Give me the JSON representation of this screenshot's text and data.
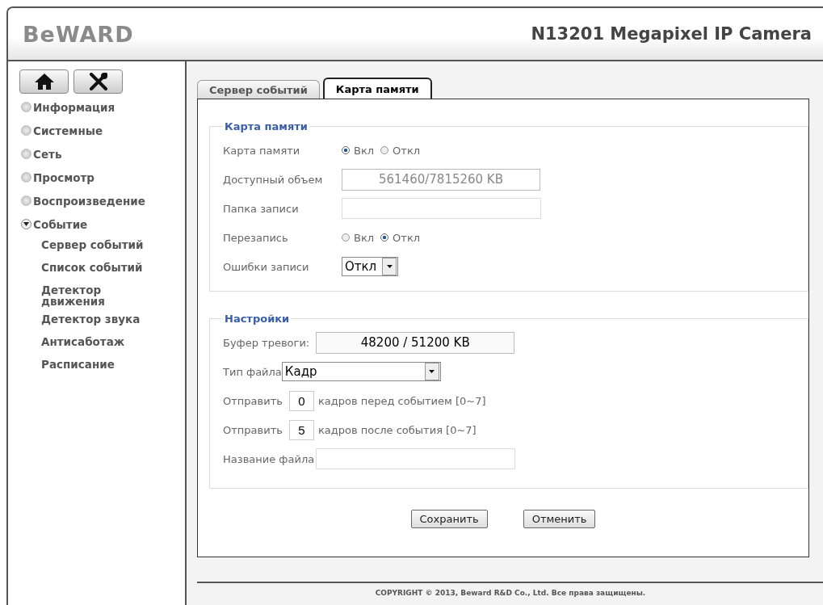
{
  "header": {
    "logo": "BeWARD",
    "title": "N13201 Megapixel IP Camera"
  },
  "sidebar": {
    "items": [
      {
        "label": "Информация",
        "expanded": false
      },
      {
        "label": "Системные",
        "expanded": false
      },
      {
        "label": "Сеть",
        "expanded": false
      },
      {
        "label": "Просмотр",
        "expanded": false
      },
      {
        "label": "Воспроизведение",
        "expanded": false
      },
      {
        "label": "Событие",
        "expanded": true,
        "children": [
          {
            "label": "Сервер событий"
          },
          {
            "label": "Список событий"
          },
          {
            "label": "Детектор движения"
          },
          {
            "label": "Детектор звука"
          },
          {
            "label": "Антисаботаж"
          },
          {
            "label": "Расписание"
          }
        ]
      }
    ]
  },
  "tabs": [
    {
      "label": "Сервер событий",
      "selected": false
    },
    {
      "label": "Карта памяти",
      "selected": true
    }
  ],
  "sections": [
    {
      "title": "Карта памяти",
      "rows": [
        {
          "kind": "radio",
          "label": "Карта памяти",
          "options": [
            {
              "label": "Вкл",
              "selected": true
            },
            {
              "label": "Откл",
              "selected": false
            }
          ]
        },
        {
          "kind": "readonly",
          "label": "Доступный объем",
          "value": "561460/7815260 KB",
          "disabled": true
        },
        {
          "kind": "text",
          "label": "Папка записи"
        },
        {
          "kind": "radio",
          "label": "Перезапись",
          "options": [
            {
              "label": "Вкл",
              "selected": false
            },
            {
              "label": "Откл",
              "selected": true
            }
          ]
        },
        {
          "kind": "select",
          "label": "Ошибки записи",
          "value": "Откл"
        }
      ]
    },
    {
      "title": "Настройки",
      "rows": [
        {
          "kind": "readonly",
          "label": "Буфер тревоги:",
          "value": "48200 / 51200 KB",
          "disabled": false
        },
        {
          "kind": "select",
          "label": "Тип файла",
          "value": "Кадр"
        },
        {
          "kind": "number",
          "label": "Отправить",
          "value": "0",
          "suffix": "кадров перед событием [0~7]"
        },
        {
          "kind": "number",
          "label": "Отправить",
          "value": "5",
          "suffix": "кадров после события [0~7]"
        },
        {
          "kind": "text",
          "label": "Название файла"
        }
      ]
    }
  ],
  "buttons": [
    "Сохранить",
    "Отменить"
  ],
  "footer": "COPYRIGHT © 2013, Beward R&D Co., Ltd. Все права защищены."
}
